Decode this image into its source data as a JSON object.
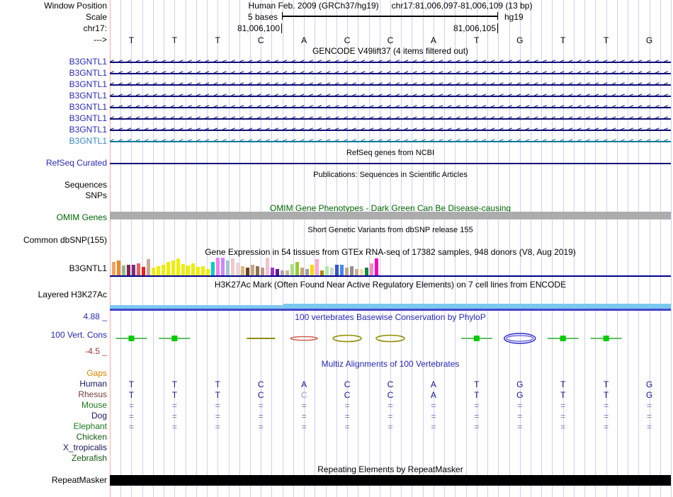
{
  "canvas": {
    "background": "#FFFFFF",
    "gridline_color": "#CFCFEF",
    "edge_line_color": "#FFA8A8"
  },
  "header": {
    "window_position_label": "Window Position",
    "assembly_position": "Human Feb. 2009 (GRCh37/hg19)",
    "position": "chr17:81,006,097-81,006,109 (13 bp)",
    "scale_label": "Scale",
    "scale_value": "5 bases",
    "assembly_tag": "hg19",
    "chrom_label": "chr17:",
    "coord_left": "81,006,100",
    "coord_right": "81,006,105",
    "strand_arrow": "--->"
  },
  "ruler": {
    "bases": [
      "T",
      "T",
      "T",
      "C",
      "A",
      "C",
      "C",
      "A",
      "T",
      "G",
      "T",
      "T",
      "G"
    ],
    "base_color": "#000000"
  },
  "gencode": {
    "title": "GENCODE V49lift37 (4 items filtered out)",
    "chevron": "<",
    "transcripts": [
      {
        "label": "B3GNTL1",
        "label_color": "#2828B2",
        "color": "#0C0C78"
      },
      {
        "label": "B3GNTL1",
        "label_color": "#2828B2",
        "color": "#0C0C78"
      },
      {
        "label": "B3GNTL1",
        "label_color": "#2828B2",
        "color": "#0C0C78"
      },
      {
        "label": "B3GNTL1",
        "label_color": "#2828B2",
        "color": "#0C0C78"
      },
      {
        "label": "B3GNTL1",
        "label_color": "#2828B2",
        "color": "#0C0C78"
      },
      {
        "label": "B3GNTL1",
        "label_color": "#2828B2",
        "color": "#0C0C78"
      },
      {
        "label": "B3GNTL1",
        "label_color": "#2828B2",
        "color": "#0C0C78"
      },
      {
        "label": "B3GNTL1",
        "label_color": "#3A87C2",
        "color": "#0C7896"
      }
    ]
  },
  "refseq": {
    "title": "RefSeq genes from NCBI",
    "label": "RefSeq Curated",
    "label_color": "#2828B2",
    "line_color": "#0C0C78"
  },
  "publications": {
    "title": "Publications: Sequences in Scientific Articles",
    "sequences_label": "Sequences",
    "snps_label": "SNPs"
  },
  "omim": {
    "title": "OMIM Gene Phenotypes - Dark Green Can Be Disease-causing",
    "title_color": "#006400",
    "label": "OMIM Genes",
    "label_color": "#006400",
    "bar_color": "#ACACAC"
  },
  "dbsnp": {
    "title": "Short Genetic Variants from dbSNP release 155",
    "label": "Common dbSNP(155)"
  },
  "gtex": {
    "title": "Gene Expression in 54 tissues from GTEx RNA-seq of 17382 samples, 948 donors (V8, Aug 2019)",
    "label": "B3GNTL1",
    "baseline_color": "#00008B",
    "chart_data": {
      "type": "bar",
      "title": "Gene Expression in 54 tissues from GTEx RNA-seq of 17382 samples, 948 donors (V8, Aug 2019)",
      "gene": "B3GNTL1",
      "n_tissues": 54,
      "bars": [
        {
          "color": "#F4A460",
          "value": 19
        },
        {
          "color": "#EE8822",
          "value": 21
        },
        {
          "color": "#8FBC8F",
          "value": 14
        },
        {
          "color": "#8B2252",
          "value": 15
        },
        {
          "color": "#7A2E7A",
          "value": 15
        },
        {
          "color": "#E85F5F",
          "value": 17
        },
        {
          "color": "#EE2222",
          "value": 12
        },
        {
          "color": "#C8A89A",
          "value": 23
        },
        {
          "color": "#EEEE00",
          "value": 11
        },
        {
          "color": "#EEEE00",
          "value": 13
        },
        {
          "color": "#EEEE00",
          "value": 15
        },
        {
          "color": "#EEEE00",
          "value": 19
        },
        {
          "color": "#EEEE00",
          "value": 21
        },
        {
          "color": "#EEEE00",
          "value": 24
        },
        {
          "color": "#EEEE00",
          "value": 16
        },
        {
          "color": "#EEEE00",
          "value": 14
        },
        {
          "color": "#EEEE00",
          "value": 17
        },
        {
          "color": "#EEEE00",
          "value": 12
        },
        {
          "color": "#EEEE00",
          "value": 13
        },
        {
          "color": "#EEEE00",
          "value": 9
        },
        {
          "color": "#00CCCC",
          "value": 19
        },
        {
          "color": "#EE82EE",
          "value": 25
        },
        {
          "color": "#CC88FF",
          "value": 25
        },
        {
          "color": "#9FC5D8",
          "value": 21
        },
        {
          "color": "#F2C8C8",
          "value": 24
        },
        {
          "color": "#EED5D5",
          "value": 18
        },
        {
          "color": "#DDB877",
          "value": 13
        },
        {
          "color": "#6B4226",
          "value": 11
        },
        {
          "color": "#C8A878",
          "value": 15
        },
        {
          "color": "#8B7355",
          "value": 13
        },
        {
          "color": "#BB9988",
          "value": 11
        },
        {
          "color": "#F2C2CC",
          "value": 25
        },
        {
          "color": "#9933CC",
          "value": 11
        },
        {
          "color": "#661199",
          "value": 9
        },
        {
          "color": "#A8A8A8",
          "value": 7
        },
        {
          "color": "#C8B89A",
          "value": 7
        },
        {
          "color": "#AADD88",
          "value": 16
        },
        {
          "color": "#99CC33",
          "value": 19
        },
        {
          "color": "#C8A878",
          "value": 11
        },
        {
          "color": "#A0A0A0",
          "value": 9
        },
        {
          "color": "#FFD700",
          "value": 15
        },
        {
          "color": "#FFAACC",
          "value": 23
        },
        {
          "color": "#B8860B",
          "value": 7
        },
        {
          "color": "#AAEEAA",
          "value": 13
        },
        {
          "color": "#D3D3D3",
          "value": 11
        },
        {
          "color": "#3355CC",
          "value": 15
        },
        {
          "color": "#4488EE",
          "value": 15
        },
        {
          "color": "#C2A684",
          "value": 11
        },
        {
          "color": "#909090",
          "value": 13
        },
        {
          "color": "#C8B090",
          "value": 9
        },
        {
          "color": "#FFDDAA",
          "value": 9
        },
        {
          "color": "#118844",
          "value": 11
        },
        {
          "color": "#FF88BB",
          "value": 17
        },
        {
          "color": "#FF00BB",
          "value": 24
        }
      ]
    }
  },
  "h3k27ac": {
    "title": "H3K27Ac Mark (Often Found Near Active Regulatory Elements) on 7 cell lines from ENCODE",
    "label": "Layered H3K27Ac",
    "signal_color": "#7AC8EE",
    "base_signal_color": "#4646CC"
  },
  "conservation": {
    "title": "100 vertebrates Basewise Conservation by PhyloP",
    "title_color": "#2828B2",
    "label": "100 Vert. Cons",
    "label_color": "#2828B2",
    "max_label": "4.88 _",
    "min_label": "-4.5 _",
    "min_label_color": "#993333",
    "glyph_colors": {
      "green_line": "#5FBF5F",
      "green_square": "#00CC00",
      "olive": "#8E8E00",
      "red": "#CC5544",
      "blue": "#2929CC"
    },
    "glyphs": [
      "green",
      "green",
      "none",
      "olive-line",
      "red-arc",
      "olive-lens",
      "olive-lens",
      "none",
      "green",
      "blue-ellipse",
      "green",
      "green",
      "none"
    ]
  },
  "multiz": {
    "title": "Multiz Alignments of 100 Vertebrates",
    "title_color": "#2828B2",
    "gap_symbol": "=",
    "gap_color": "#7878B8",
    "rows": [
      {
        "label": "Gaps",
        "label_color": "#DD8800",
        "type": "empty"
      },
      {
        "label": "Human",
        "label_color": "#16165E",
        "type": "bases",
        "cell_color": "#15158B",
        "cells": [
          "T",
          "T",
          "T",
          "C",
          "A",
          "C",
          "C",
          "A",
          "T",
          "G",
          "T",
          "T",
          "G"
        ]
      },
      {
        "label": "Rhesus",
        "label_color": "#7A3A3A",
        "type": "bases",
        "cell_color": "#15158B",
        "cells": [
          "T",
          "T",
          "T",
          "C",
          "C",
          "C",
          "C",
          "A",
          "T",
          "G",
          "T",
          "T",
          "G"
        ],
        "dim_indices": [
          4
        ],
        "dim_color": "#9898CC"
      },
      {
        "label": "Mouse",
        "label_color": "#1E7A1E",
        "type": "gaps"
      },
      {
        "label": "Dog",
        "label_color": "#16165E",
        "type": "gaps"
      },
      {
        "label": "Elephant",
        "label_color": "#1E7A1E",
        "type": "gaps"
      },
      {
        "label": "Chicken",
        "label_color": "#115511",
        "type": "empty"
      },
      {
        "label": "X_tropicalis",
        "label_color": "#16165E",
        "type": "empty"
      },
      {
        "label": "Zebrafish",
        "label_color": "#115511",
        "type": "empty"
      }
    ]
  },
  "repeatmasker": {
    "title": "Repeating Elements by RepeatMasker",
    "label": "RepeatMasker",
    "bar_color": "#000000"
  }
}
